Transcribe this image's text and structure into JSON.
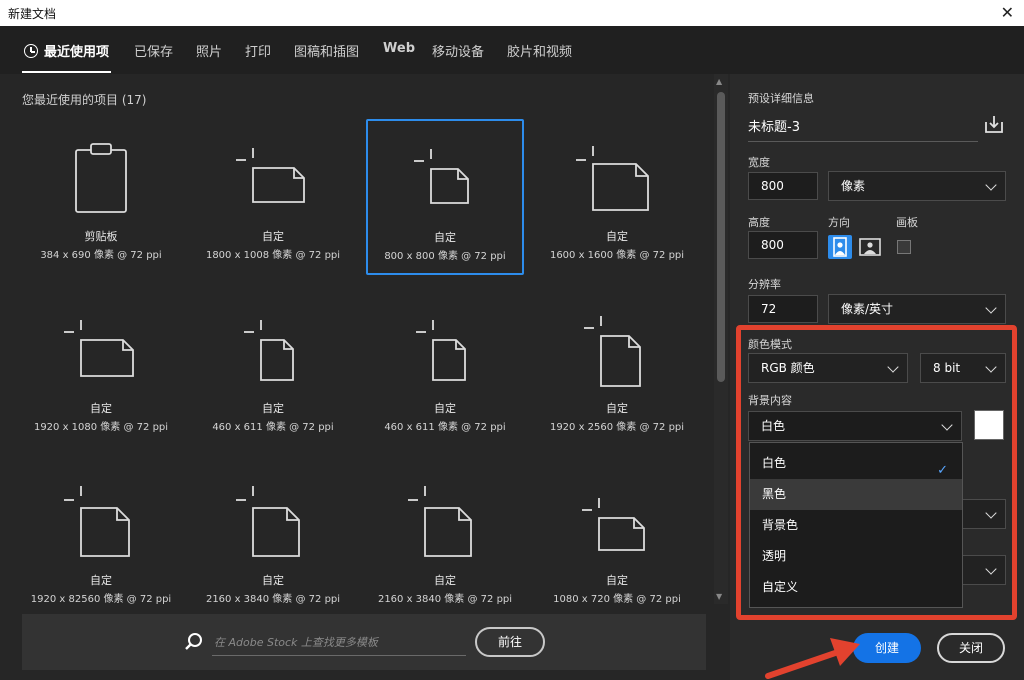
{
  "window": {
    "title": "新建文档",
    "close_glyph": "✕"
  },
  "tabs": [
    {
      "label": "最近使用项",
      "active": true,
      "icon": "clock-icon"
    },
    {
      "label": "已保存"
    },
    {
      "label": "照片"
    },
    {
      "label": "打印"
    },
    {
      "label": "图稿和插图"
    },
    {
      "label": "Web"
    },
    {
      "label": "移动设备"
    },
    {
      "label": "胶片和视频"
    }
  ],
  "recent": {
    "title": "您最近使用的项目 (17)",
    "items": [
      {
        "name": "剪贴板",
        "size": "384 x 690 像素 @ 72 ppi",
        "icon": "clipboard-icon"
      },
      {
        "name": "自定",
        "size": "1800 x 1008 像素 @ 72 ppi",
        "icon": "landscape-doc-icon"
      },
      {
        "name": "自定",
        "size": "800 x 800 像素 @ 72 ppi",
        "icon": "square-doc-icon",
        "selected": true
      },
      {
        "name": "自定",
        "size": "1600 x 1600 像素 @ 72 ppi",
        "icon": "square-doc-icon"
      },
      {
        "name": "自定",
        "size": "1920 x 1080 像素 @ 72 ppi",
        "icon": "landscape-doc-icon"
      },
      {
        "name": "自定",
        "size": "460 x 611 像素 @ 72 ppi",
        "icon": "portrait-doc-icon"
      },
      {
        "name": "自定",
        "size": "460 x 611 像素 @ 72 ppi",
        "icon": "portrait-doc-icon"
      },
      {
        "name": "自定",
        "size": "1920 x 2560 像素 @ 72 ppi",
        "icon": "portrait-doc-icon"
      },
      {
        "name": "自定",
        "size": "1920 x 82560 像素 @ 72 ppi",
        "icon": "portrait-doc-icon"
      },
      {
        "name": "自定",
        "size": "2160 x 3840 像素 @ 72 ppi",
        "icon": "portrait-doc-icon"
      },
      {
        "name": "自定",
        "size": "2160 x 3840 像素 @ 72 ppi",
        "icon": "portrait-doc-icon"
      },
      {
        "name": "自定",
        "size": "1080 x 720 像素 @ 72 ppi",
        "icon": "landscape-doc-icon"
      }
    ]
  },
  "stock": {
    "placeholder": "在 Adobe Stock 上查找更多模板",
    "go_label": "前往"
  },
  "details": {
    "section_label": "预设详细信息",
    "name": "未标题-3",
    "width_label": "宽度",
    "width": "800",
    "width_unit": "像素",
    "height_label": "高度",
    "height": "800",
    "orientation_label": "方向",
    "artboard_label": "画板",
    "resolution_label": "分辨率",
    "resolution": "72",
    "resolution_unit": "像素/英寸",
    "color_mode_label": "颜色模式",
    "color_mode": "RGB 颜色",
    "bit_depth": "8 bit",
    "background_label": "背景内容",
    "background": "白色"
  },
  "background_options": [
    {
      "label": "白色",
      "checked": true
    },
    {
      "label": "黑色",
      "hover": true
    },
    {
      "label": "背景色"
    },
    {
      "label": "透明"
    },
    {
      "label": "自定义"
    }
  ],
  "actions": {
    "create": "创建",
    "close": "关闭"
  },
  "colors": {
    "accent": "#1473e6",
    "highlight": "#e2422e",
    "selection": "#2d8ceb"
  }
}
